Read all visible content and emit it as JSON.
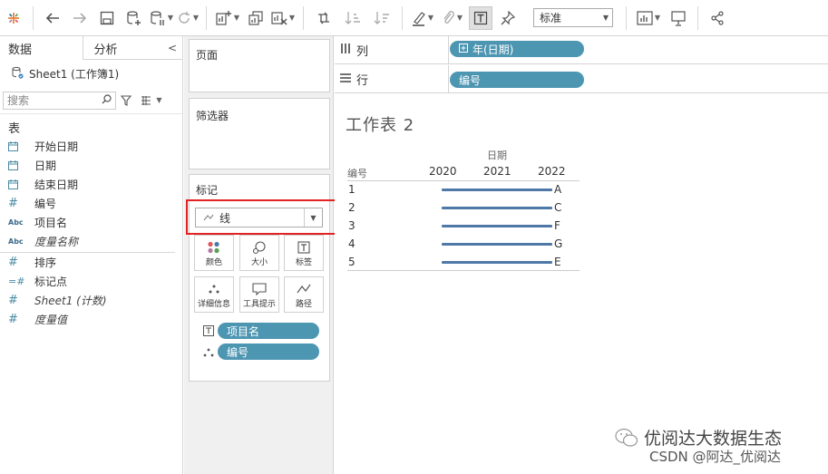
{
  "toolbar": {
    "fit_select": "标准"
  },
  "data_pane": {
    "tab_data": "数据",
    "tab_analytics": "分析",
    "datasource": "Sheet1 (工作簿1)",
    "search_placeholder": "搜索",
    "section_tables": "表",
    "fields": [
      {
        "icon": "date-icon",
        "label": "开始日期"
      },
      {
        "icon": "date-icon",
        "label": "日期"
      },
      {
        "icon": "date-icon",
        "label": "结束日期"
      },
      {
        "icon": "number-icon",
        "label": "编号"
      },
      {
        "icon": "string-icon",
        "label": "项目名"
      },
      {
        "icon": "string-icon",
        "label": "度量名称"
      },
      {
        "icon": "number-icon",
        "label": "排序"
      },
      {
        "icon": "bin-number-icon",
        "label": "标记点"
      },
      {
        "icon": "number-icon",
        "label": "Sheet1 (计数)"
      },
      {
        "icon": "number-icon",
        "label": "度量值"
      }
    ],
    "abc": "Abc"
  },
  "cards": {
    "pages": "页面",
    "filters": "筛选器",
    "marks": "标记",
    "mark_type": "线",
    "buttons": [
      "颜色",
      "大小",
      "标签",
      "详细信息",
      "工具提示",
      "路径"
    ],
    "mark_pills": [
      "项目名",
      "编号"
    ]
  },
  "shelves": {
    "columns_label": "列",
    "columns_pill": "年(日期)",
    "rows_label": "行",
    "rows_pill": "编号"
  },
  "view": {
    "sheet_title": "工作表 2",
    "column_header": "日期",
    "row_header": "编号",
    "years": [
      "2020",
      "2021",
      "2022"
    ],
    "rows": [
      {
        "id": "1",
        "label": "A"
      },
      {
        "id": "2",
        "label": "C"
      },
      {
        "id": "3",
        "label": "F"
      },
      {
        "id": "4",
        "label": "G"
      },
      {
        "id": "5",
        "label": "E"
      }
    ],
    "line_color": "#4e79a7"
  },
  "watermark": {
    "line1": "优阅达大数据生态",
    "line2": "CSDN @阿达_优阅达"
  }
}
